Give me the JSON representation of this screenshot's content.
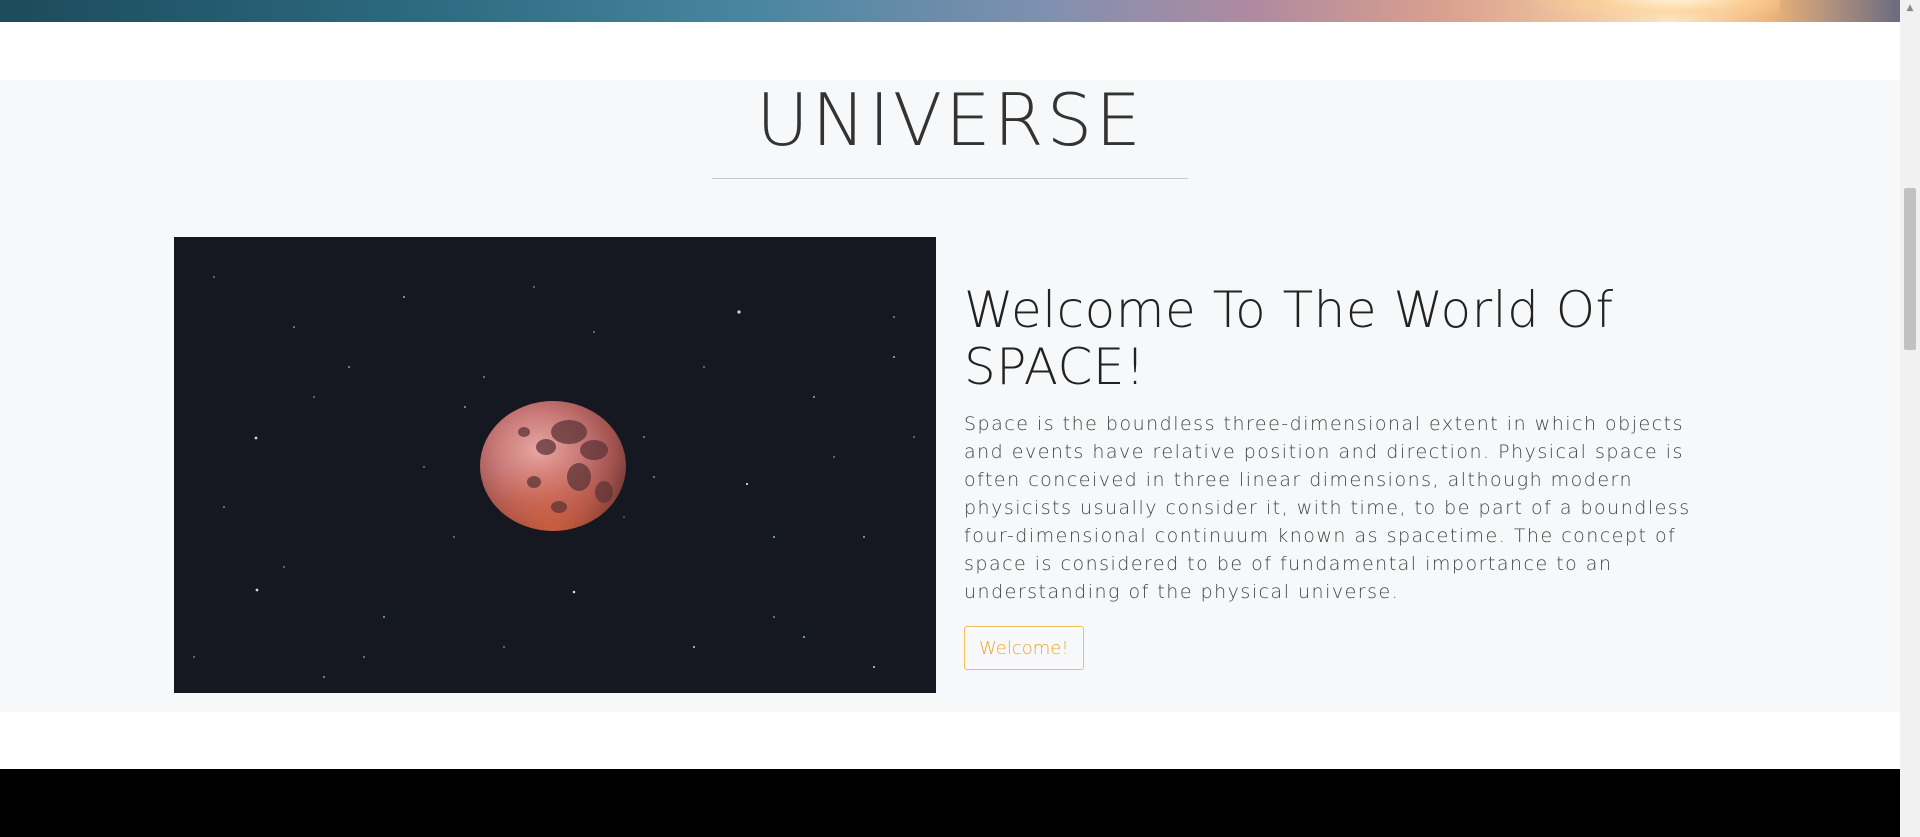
{
  "section": {
    "title": "UNIVERSE"
  },
  "feature": {
    "heading": "Welcome To The World Of SPACE!",
    "description": "Space is the boundless three-dimensional extent in which objects and events have relative position and direction. Physical space is often conceived in three linear dimensions, although modern physicists usually consider it, with time, to be part of a boundless four-dimensional continuum known as spacetime. The concept of space is considered to be of fundamental importance to an understanding of the physical universe.",
    "button_label": "Welcome!",
    "image_icon": "moon-in-starfield"
  },
  "colors": {
    "accent": "#eaa92a",
    "section_bg": "#f7f8f9",
    "footer_bg": "#000000"
  }
}
